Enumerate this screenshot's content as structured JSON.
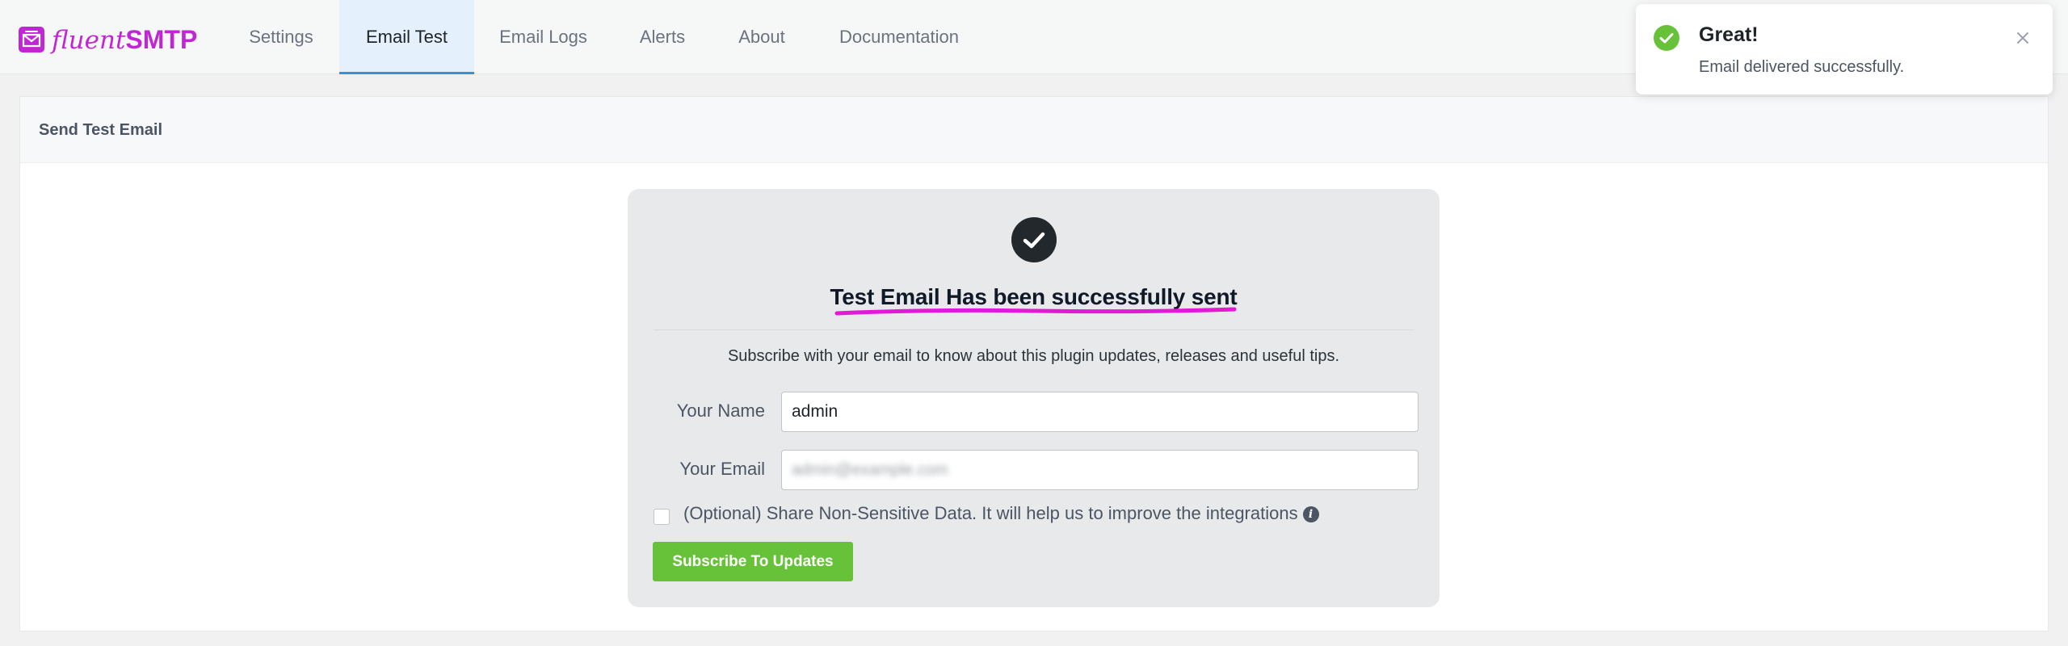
{
  "app": {
    "logo_prefix": "fluent",
    "logo_suffix": "SMTP",
    "brand_color": "#c026d3"
  },
  "nav": {
    "tabs": [
      {
        "label": "Settings",
        "active": false
      },
      {
        "label": "Email Test",
        "active": true
      },
      {
        "label": "Email Logs",
        "active": false
      },
      {
        "label": "Alerts",
        "active": false
      },
      {
        "label": "About",
        "active": false
      },
      {
        "label": "Documentation",
        "active": false
      }
    ],
    "active_color": "#3b8fd4"
  },
  "panel": {
    "title": "Send Test Email"
  },
  "card": {
    "icon": "check-icon",
    "title": "Test Email Has been successfully sent",
    "subscribe_text": "Subscribe with your email to know about this plugin updates, releases and useful tips.",
    "name_label": "Your Name",
    "name_value": "admin",
    "email_label": "Your Email",
    "email_value": "admin@example.com",
    "optional_text": "(Optional) Share Non-Sensitive Data. It will help us to improve the integrations",
    "optional_checked": false,
    "info_icon": "info-icon",
    "button_label": "Subscribe To Updates",
    "button_color": "#67c23a",
    "highlight_color": "#e01ad6"
  },
  "toast": {
    "icon": "success-check-icon",
    "title": "Great!",
    "message": "Email delivered successfully.",
    "close_icon": "close-icon",
    "success_color": "#67c23a"
  }
}
